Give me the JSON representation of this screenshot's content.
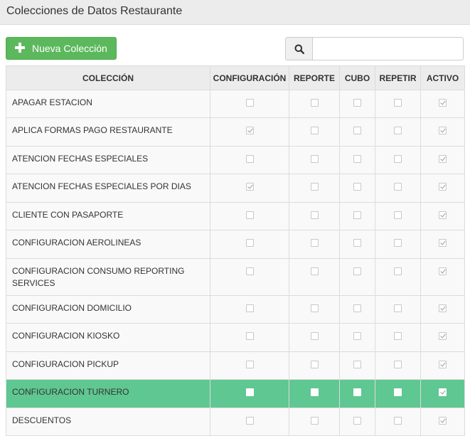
{
  "header": {
    "title": "Colecciones de Datos Restaurante"
  },
  "toolbar": {
    "new_button_label": "Nueva Colección",
    "search_placeholder": ""
  },
  "colors": {
    "accent_green": "#5cb85c",
    "selected_row": "#5fc791"
  },
  "icons": {
    "new_button": "plus-icon",
    "search_button": "search-icon"
  },
  "table": {
    "columns": [
      "COLECCIÓN",
      "CONFIGURACIÓN",
      "REPORTE",
      "CUBO",
      "REPETIR",
      "ACTIVO"
    ],
    "rows": [
      {
        "name": "APAGAR ESTACION",
        "configuracion": false,
        "reporte": false,
        "cubo": false,
        "repetir": false,
        "activo": true,
        "selected": false
      },
      {
        "name": "APLICA FORMAS PAGO RESTAURANTE",
        "configuracion": true,
        "reporte": false,
        "cubo": false,
        "repetir": false,
        "activo": true,
        "selected": false
      },
      {
        "name": "ATENCION FECHAS ESPECIALES",
        "configuracion": false,
        "reporte": false,
        "cubo": false,
        "repetir": false,
        "activo": true,
        "selected": false
      },
      {
        "name": "ATENCION FECHAS ESPECIALES POR DIAS",
        "configuracion": true,
        "reporte": false,
        "cubo": false,
        "repetir": false,
        "activo": true,
        "selected": false
      },
      {
        "name": "CLIENTE CON PASAPORTE",
        "configuracion": false,
        "reporte": false,
        "cubo": false,
        "repetir": false,
        "activo": true,
        "selected": false
      },
      {
        "name": "CONFIGURACION AEROLINEAS",
        "configuracion": false,
        "reporte": false,
        "cubo": false,
        "repetir": false,
        "activo": true,
        "selected": false
      },
      {
        "name": "CONFIGURACION CONSUMO REPORTING SERVICES",
        "configuracion": false,
        "reporte": false,
        "cubo": false,
        "repetir": false,
        "activo": true,
        "selected": false
      },
      {
        "name": "CONFIGURACION DOMICILIO",
        "configuracion": false,
        "reporte": false,
        "cubo": false,
        "repetir": false,
        "activo": true,
        "selected": false
      },
      {
        "name": "CONFIGURACION KIOSKO",
        "configuracion": false,
        "reporte": false,
        "cubo": false,
        "repetir": false,
        "activo": true,
        "selected": false
      },
      {
        "name": "CONFIGURACION PICKUP",
        "configuracion": false,
        "reporte": false,
        "cubo": false,
        "repetir": false,
        "activo": true,
        "selected": false
      },
      {
        "name": "CONFIGURACION TURNERO",
        "configuracion": false,
        "reporte": false,
        "cubo": false,
        "repetir": false,
        "activo": true,
        "selected": true
      },
      {
        "name": "DESCUENTOS",
        "configuracion": false,
        "reporte": false,
        "cubo": false,
        "repetir": false,
        "activo": true,
        "selected": false
      }
    ]
  }
}
